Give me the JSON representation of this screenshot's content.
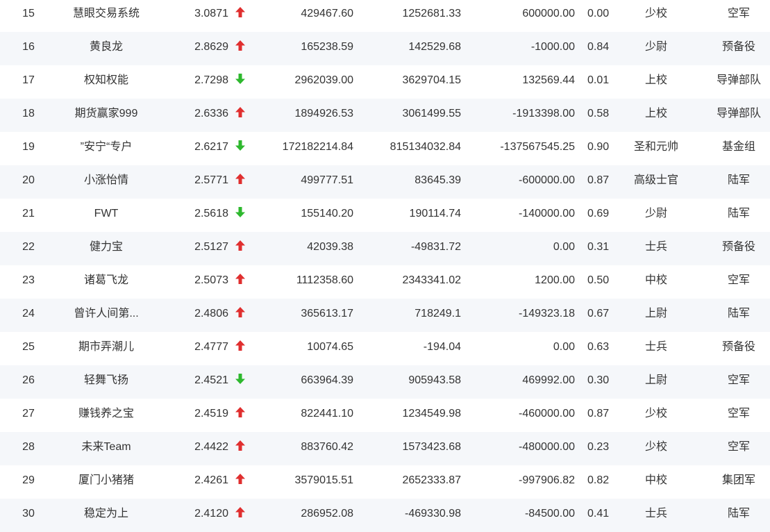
{
  "colors": {
    "up": "#e02f2f",
    "down": "#2eb82e",
    "text": "#333333",
    "stripe": "#f5f7fa"
  },
  "rows": [
    {
      "rank": "15",
      "name": "慧眼交易系统",
      "score": "3.0871",
      "trend": "up",
      "v1": "429467.60",
      "v2": "1252681.33",
      "v3": "600000.00",
      "ratio": "0.00",
      "title": "少校",
      "group": "空军"
    },
    {
      "rank": "16",
      "name": "黄良龙",
      "score": "2.8629",
      "trend": "up",
      "v1": "165238.59",
      "v2": "142529.68",
      "v3": "-1000.00",
      "ratio": "0.84",
      "title": "少尉",
      "group": "预备役"
    },
    {
      "rank": "17",
      "name": "权知权能",
      "score": "2.7298",
      "trend": "down",
      "v1": "2962039.00",
      "v2": "3629704.15",
      "v3": "132569.44",
      "ratio": "0.01",
      "title": "上校",
      "group": "导弹部队"
    },
    {
      "rank": "18",
      "name": "期货赢家999",
      "score": "2.6336",
      "trend": "up",
      "v1": "1894926.53",
      "v2": "3061499.55",
      "v3": "-1913398.00",
      "ratio": "0.58",
      "title": "上校",
      "group": "导弹部队"
    },
    {
      "rank": "19",
      "name": "”安宁“专户",
      "score": "2.6217",
      "trend": "down",
      "v1": "172182214.84",
      "v2": "815134032.84",
      "v3": "-137567545.25",
      "ratio": "0.90",
      "title": "圣和元帅",
      "group": "基金组"
    },
    {
      "rank": "20",
      "name": "小涨怡情",
      "score": "2.5771",
      "trend": "up",
      "v1": "499777.51",
      "v2": "83645.39",
      "v3": "-600000.00",
      "ratio": "0.87",
      "title": "高级士官",
      "group": "陆军"
    },
    {
      "rank": "21",
      "name": "FWT",
      "score": "2.5618",
      "trend": "down",
      "v1": "155140.20",
      "v2": "190114.74",
      "v3": "-140000.00",
      "ratio": "0.69",
      "title": "少尉",
      "group": "陆军"
    },
    {
      "rank": "22",
      "name": "健力宝",
      "score": "2.5127",
      "trend": "up",
      "v1": "42039.38",
      "v2": "-49831.72",
      "v3": "0.00",
      "ratio": "0.31",
      "title": "士兵",
      "group": "预备役"
    },
    {
      "rank": "23",
      "name": "诸葛飞龙",
      "score": "2.5073",
      "trend": "up",
      "v1": "1112358.60",
      "v2": "2343341.02",
      "v3": "1200.00",
      "ratio": "0.50",
      "title": "中校",
      "group": "空军"
    },
    {
      "rank": "24",
      "name": "曾许人间第...",
      "score": "2.4806",
      "trend": "up",
      "v1": "365613.17",
      "v2": "718249.1",
      "v3": "-149323.18",
      "ratio": "0.67",
      "title": "上尉",
      "group": "陆军"
    },
    {
      "rank": "25",
      "name": "期市弄潮儿",
      "score": "2.4777",
      "trend": "up",
      "v1": "10074.65",
      "v2": "-194.04",
      "v3": "0.00",
      "ratio": "0.63",
      "title": "士兵",
      "group": "预备役"
    },
    {
      "rank": "26",
      "name": "轻舞飞扬",
      "score": "2.4521",
      "trend": "down",
      "v1": "663964.39",
      "v2": "905943.58",
      "v3": "469992.00",
      "ratio": "0.30",
      "title": "上尉",
      "group": "空军"
    },
    {
      "rank": "27",
      "name": "赚钱养之宝",
      "score": "2.4519",
      "trend": "up",
      "v1": "822441.10",
      "v2": "1234549.98",
      "v3": "-460000.00",
      "ratio": "0.87",
      "title": "少校",
      "group": "空军"
    },
    {
      "rank": "28",
      "name": "未来Team",
      "score": "2.4422",
      "trend": "up",
      "v1": "883760.42",
      "v2": "1573423.68",
      "v3": "-480000.00",
      "ratio": "0.23",
      "title": "少校",
      "group": "空军"
    },
    {
      "rank": "29",
      "name": "厦门小猪猪",
      "score": "2.4261",
      "trend": "up",
      "v1": "3579015.51",
      "v2": "2652333.87",
      "v3": "-997906.82",
      "ratio": "0.82",
      "title": "中校",
      "group": "集团军"
    },
    {
      "rank": "30",
      "name": "稳定为上",
      "score": "2.4120",
      "trend": "up",
      "v1": "286952.08",
      "v2": "-469330.98",
      "v3": "-84500.00",
      "ratio": "0.41",
      "title": "士兵",
      "group": "陆军"
    }
  ]
}
